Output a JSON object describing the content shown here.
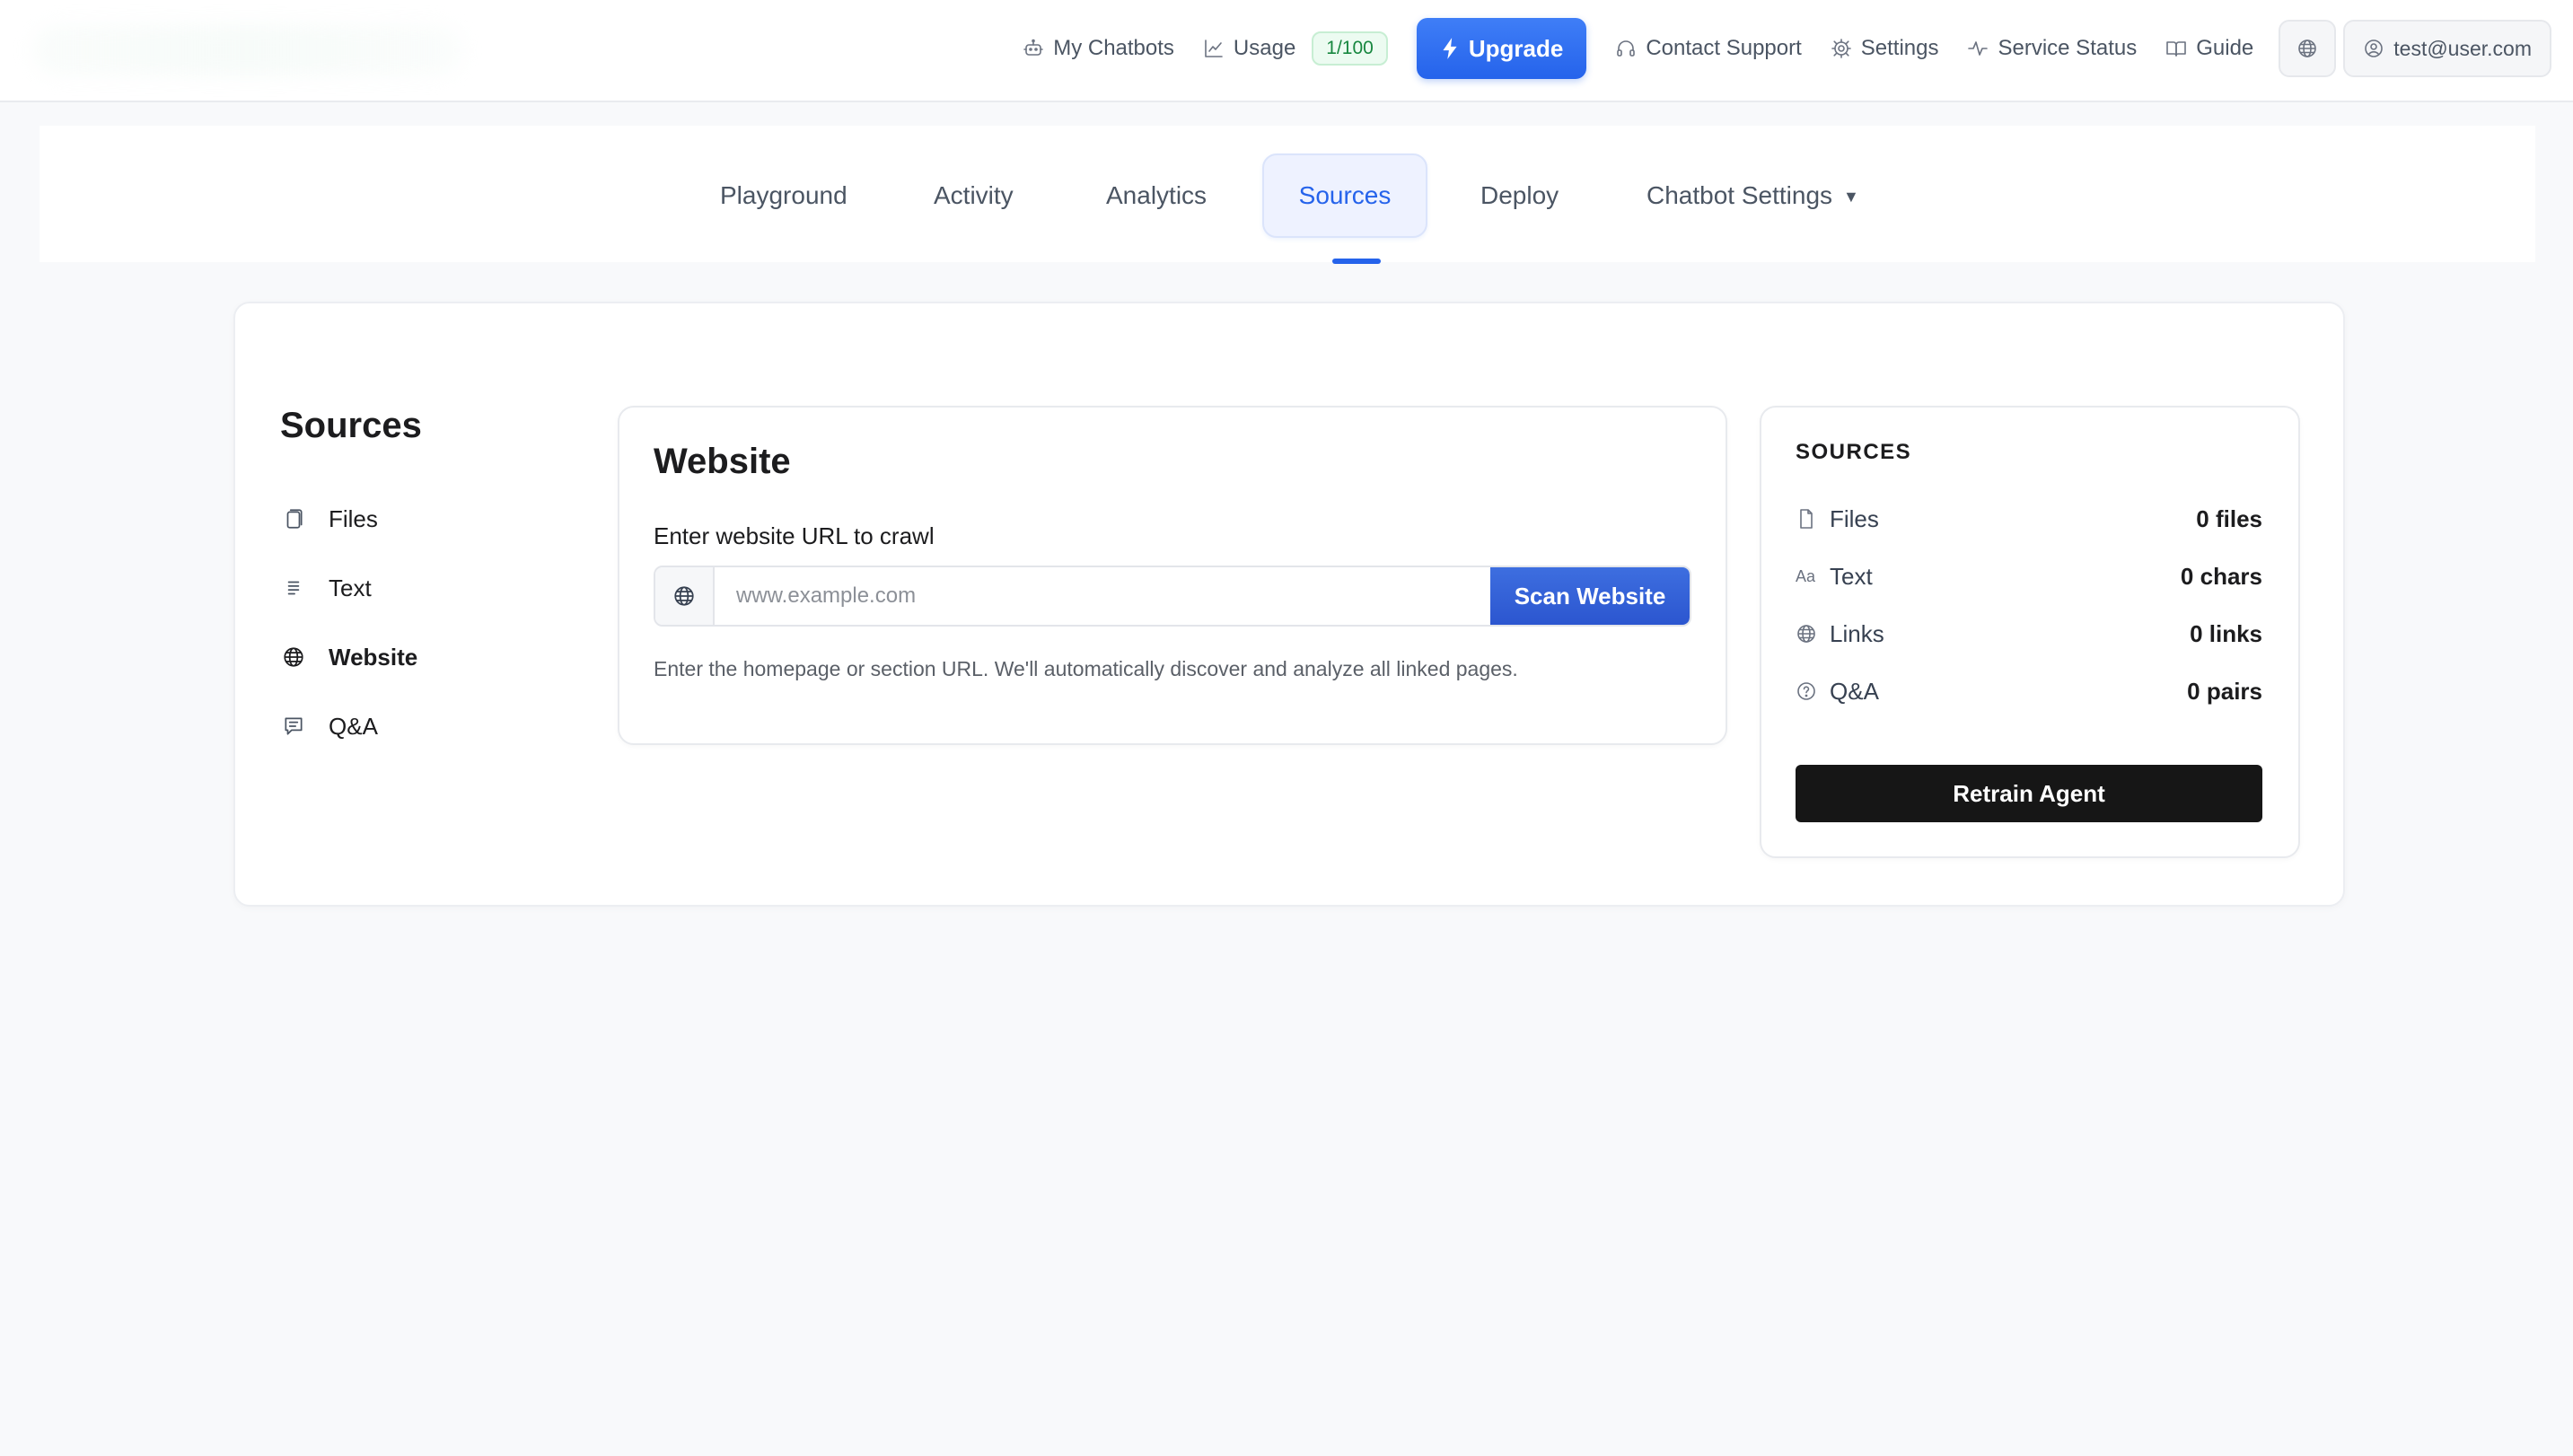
{
  "topnav": {
    "my_chatbots": "My Chatbots",
    "usage": "Usage",
    "usage_badge": "1/100",
    "upgrade": "Upgrade",
    "contact_support": "Contact Support",
    "settings": "Settings",
    "service_status": "Service Status",
    "guide": "Guide",
    "user_email": "test@user.com"
  },
  "tabs": [
    {
      "label": "Playground"
    },
    {
      "label": "Activity"
    },
    {
      "label": "Analytics"
    },
    {
      "label": "Sources",
      "active": true
    },
    {
      "label": "Deploy"
    },
    {
      "label": "Chatbot Settings",
      "caret": "▼"
    }
  ],
  "sidebar": {
    "title": "Sources",
    "items": [
      {
        "label": "Files",
        "icon": "file-copy-icon"
      },
      {
        "label": "Text",
        "icon": "text-lines-icon"
      },
      {
        "label": "Website",
        "icon": "globe-icon",
        "active": true
      },
      {
        "label": "Q&A",
        "icon": "chat-icon"
      }
    ]
  },
  "website": {
    "title": "Website",
    "label": "Enter website URL to crawl",
    "placeholder": "www.example.com",
    "scan_button": "Scan Website",
    "hint": "Enter the homepage or section URL. We'll automatically discover and analyze all linked pages."
  },
  "sources_summary": {
    "heading": "SOURCES",
    "rows": [
      {
        "label": "Files",
        "value": "0 files",
        "icon": "file-icon"
      },
      {
        "label": "Text",
        "value": "0 chars",
        "icon": "Aa"
      },
      {
        "label": "Links",
        "value": "0 links",
        "icon": "globe-icon"
      },
      {
        "label": "Q&A",
        "value": "0 pairs",
        "icon": "question-circle-icon"
      }
    ],
    "retrain_button": "Retrain Agent"
  },
  "colors": {
    "accent": "#2563eb",
    "badge_green": "#17873f",
    "retrain_bg": "#161616"
  }
}
